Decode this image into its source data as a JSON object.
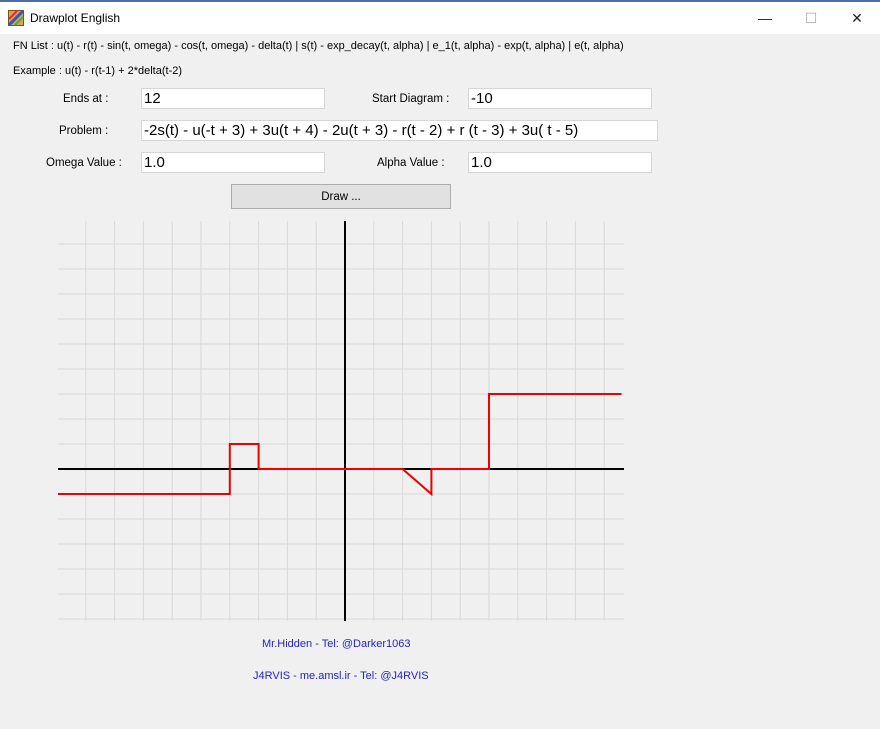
{
  "window": {
    "title": "Drawplot English",
    "controls": {
      "minimize": "—",
      "maximize": "☐",
      "close": "✕"
    }
  },
  "fn_list": "FN List : u(t) - r(t) - sin(t, omega) - cos(t, omega) - delta(t) | s(t) - exp_decay(t, alpha) | e_1(t, alpha) - exp(t, alpha) | e(t, alpha)",
  "example": "Example : u(t) - r(t-1) + 2*delta(t-2)",
  "form": {
    "ends_at_label": "Ends at :",
    "ends_at_value": "12",
    "start_label": "Start Diagram :",
    "start_value": "-10",
    "problem_label": "Problem :",
    "problem_value": "-2s(t) - u(-t + 3) + 3u(t + 4) - 2u(t + 3) - r(t - 2) + r (t - 3) + 3u( t - 5)",
    "omega_label": "Omega Value :",
    "omega_value": "1.0",
    "alpha_label": "Alpha Value :",
    "alpha_value": "1.0",
    "draw_button": "Draw ..."
  },
  "plot_colors": {
    "grid": "#d9d9d9",
    "axes": "#000000",
    "curve": "#ee0000"
  },
  "plot_series": [
    {
      "t": -10,
      "y": -1
    },
    {
      "t": -4,
      "y": -1
    },
    {
      "t": -4,
      "y": 1
    },
    {
      "t": -3,
      "y": 1
    },
    {
      "t": -3,
      "y": 0
    },
    {
      "t": 2,
      "y": 0
    },
    {
      "t": 3,
      "y": -1
    },
    {
      "t": 3,
      "y": 0
    },
    {
      "t": 5,
      "y": 0
    },
    {
      "t": 5,
      "y": 3
    },
    {
      "t": 9.6,
      "y": 3
    }
  ],
  "credits": {
    "line1": "Mr.Hidden - Tel: @Darker1063",
    "line2": "J4RVIS - me.amsl.ir - Tel: @J4RVIS"
  }
}
